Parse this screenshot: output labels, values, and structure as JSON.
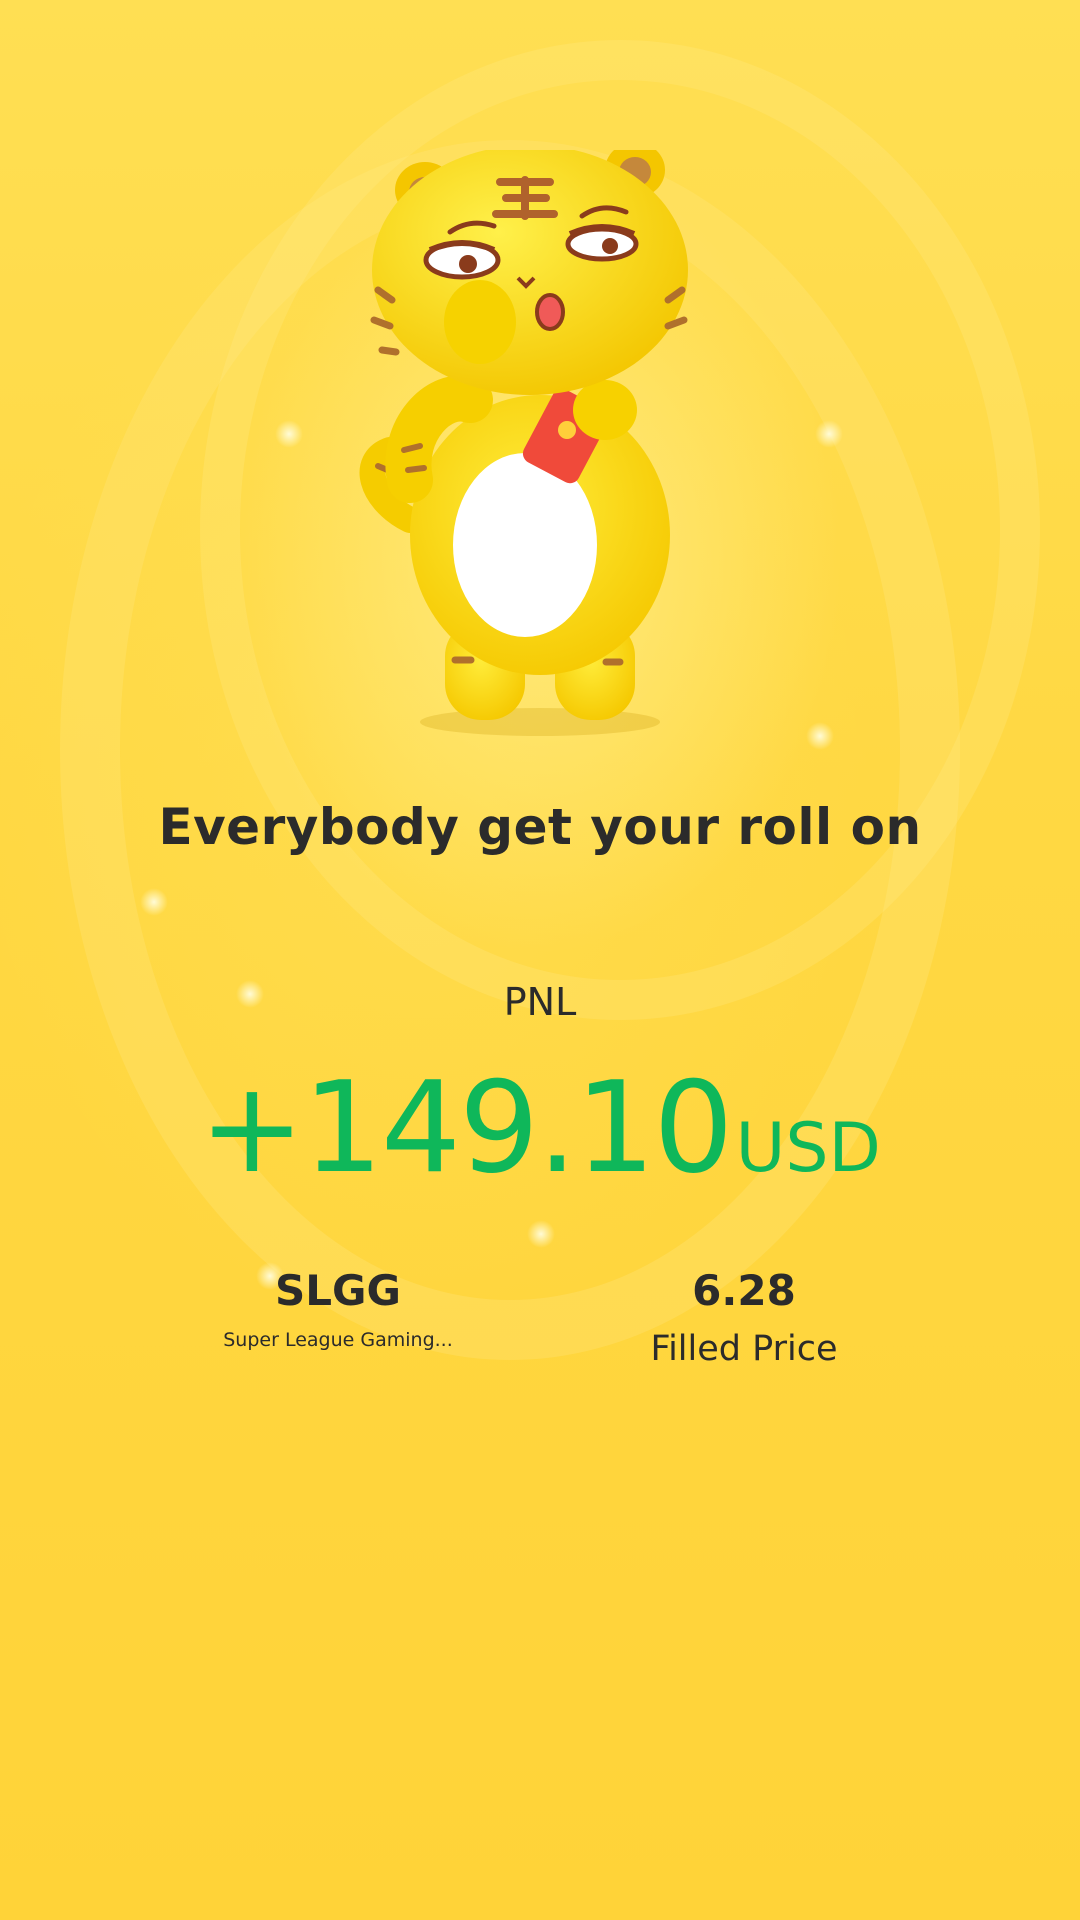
{
  "headline": "Everybody get your roll on",
  "pnl": {
    "label": "PNL",
    "value": "+149.10",
    "unit": "USD",
    "color": "#0fb75a"
  },
  "stock": {
    "ticker": "SLGG",
    "company": "Super League Gaming..."
  },
  "filled": {
    "price": "6.28",
    "label": "Filled Price"
  },
  "mascot": {
    "icon": "tiger-mascot-with-red-envelope"
  },
  "colors": {
    "background": "#ffd43e",
    "text": "#2b2b2b"
  }
}
